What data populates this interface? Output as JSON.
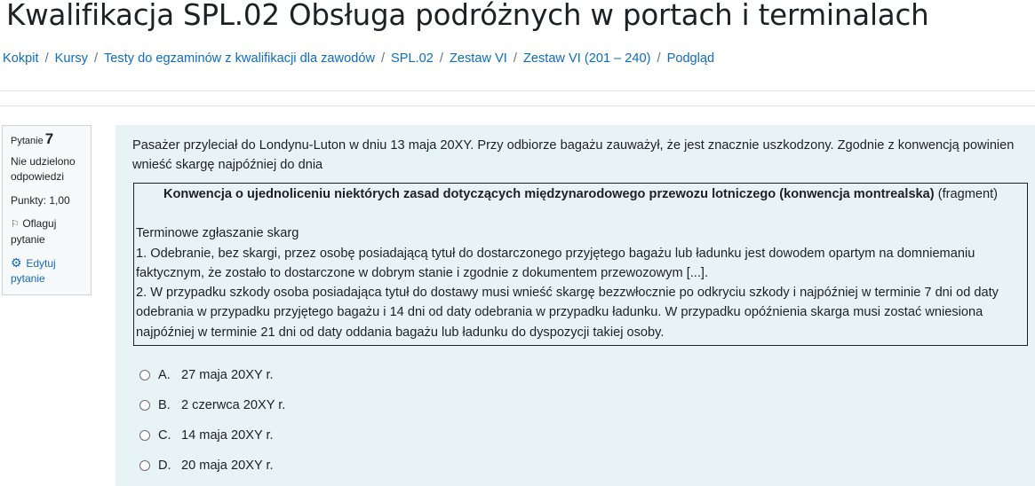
{
  "page": {
    "title": "Kwalifikacja SPL.02 Obsługa podróżnych w portach i terminalach"
  },
  "breadcrumb": [
    "Kokpit",
    "Kursy",
    "Testy do egzaminów z kwalifikacji dla zawodów",
    "SPL.02",
    "Zestaw VI",
    "Zestaw VI (201 – 240)",
    "Podgląd"
  ],
  "breadcrumb_separator": "/",
  "question_info": {
    "question_label": "Pytanie",
    "question_number": "7",
    "state_line1": "Nie udzielono",
    "state_line2": "odpowiedzi",
    "grade": "Punkty: 1,00",
    "flag_line1": "Oflaguj",
    "flag_line2": "pytanie",
    "edit_line1": "Edytuj",
    "edit_line2": "pytanie"
  },
  "question": {
    "text": "Pasażer przyleciał do Londynu-Luton w dniu 13 maja 20XY. Przy odbiorze bagażu zauważył, że jest znacznie uszkodzony. Zgodnie z konwencją powinien wnieść skargę najpóźniej do dnia",
    "fragment_title_bold": "Konwencja o ujednoliceniu niektórych zasad dotyczących międzynarodowego przewozu lotniczego (konwencja montrealska)",
    "fragment_title_suffix": "(fragment)",
    "fragment_heading": "Terminowe zgłaszanie skarg",
    "fragment_p1": "1. Odebranie, bez skargi, przez osobę posiadającą tytuł do dostarczonego przyjętego bagażu lub ładunku jest dowodem opartym na domniemaniu faktycznym, że zostało to dostarczone w dobrym stanie i zgodnie z dokumentem przewozowym [...].",
    "fragment_p2": "2. W przypadku szkody osoba posiadająca tytuł do dostawy musi wnieść skargę bezzwłocznie po odkryciu szkody i najpóźniej w terminie 7 dni od daty odebrania w przypadku przyjętego bagażu i 14 dni od daty odebrania w przypadku ładunku. W przypadku opóźnienia skarga musi zostać wniesiona najpóźniej w terminie 21 dni od daty oddania bagażu lub ładunku do dyspozycji takiej osoby."
  },
  "answers": [
    {
      "letter": "A.",
      "text": "27 maja 20XY r."
    },
    {
      "letter": "B.",
      "text": "2 czerwca 20XY r."
    },
    {
      "letter": "C.",
      "text": "14 maja 20XY r."
    },
    {
      "letter": "D.",
      "text": "20 maja 20XY r."
    }
  ],
  "icons": {
    "flag": "flag-icon",
    "edit": "gear-icon"
  },
  "colors": {
    "link": "#0f6cbf",
    "question_bg": "#e7f3f5",
    "info_bg": "#f8f9fa"
  }
}
